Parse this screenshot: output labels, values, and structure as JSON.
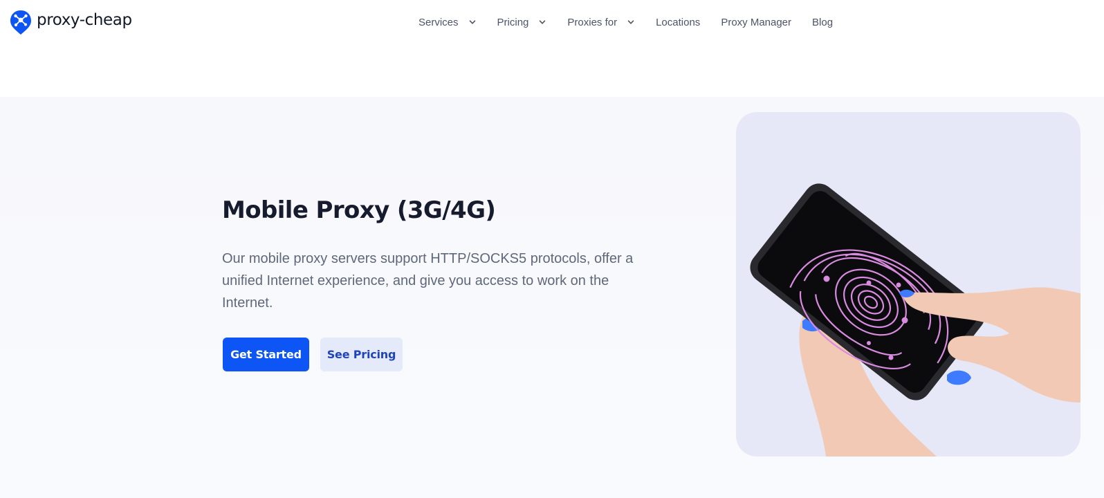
{
  "header": {
    "logo_text": "proxy-cheap",
    "nav": [
      {
        "label": "Services",
        "dropdown": true
      },
      {
        "label": "Pricing",
        "dropdown": true
      },
      {
        "label": "Proxies for",
        "dropdown": true
      },
      {
        "label": "Locations",
        "dropdown": false
      },
      {
        "label": "Proxy Manager",
        "dropdown": false
      },
      {
        "label": "Blog",
        "dropdown": false
      }
    ]
  },
  "hero": {
    "title": "Mobile Proxy (3G/4G)",
    "description": "Our mobile proxy servers support HTTP/SOCKS5 protocols, offer a unified Internet experience, and give you access to work on the Internet.",
    "primary_button": "Get Started",
    "secondary_button": "See Pricing",
    "image_icon": "hands-holding-smartphone-fingerprint-image"
  },
  "colors": {
    "brand": "#0d55f5",
    "secondary_button_bg": "#e5eafb",
    "secondary_button_text": "#1f44b8",
    "image_bg": "#e6e8f7",
    "fingerprint": "#d98be0"
  }
}
